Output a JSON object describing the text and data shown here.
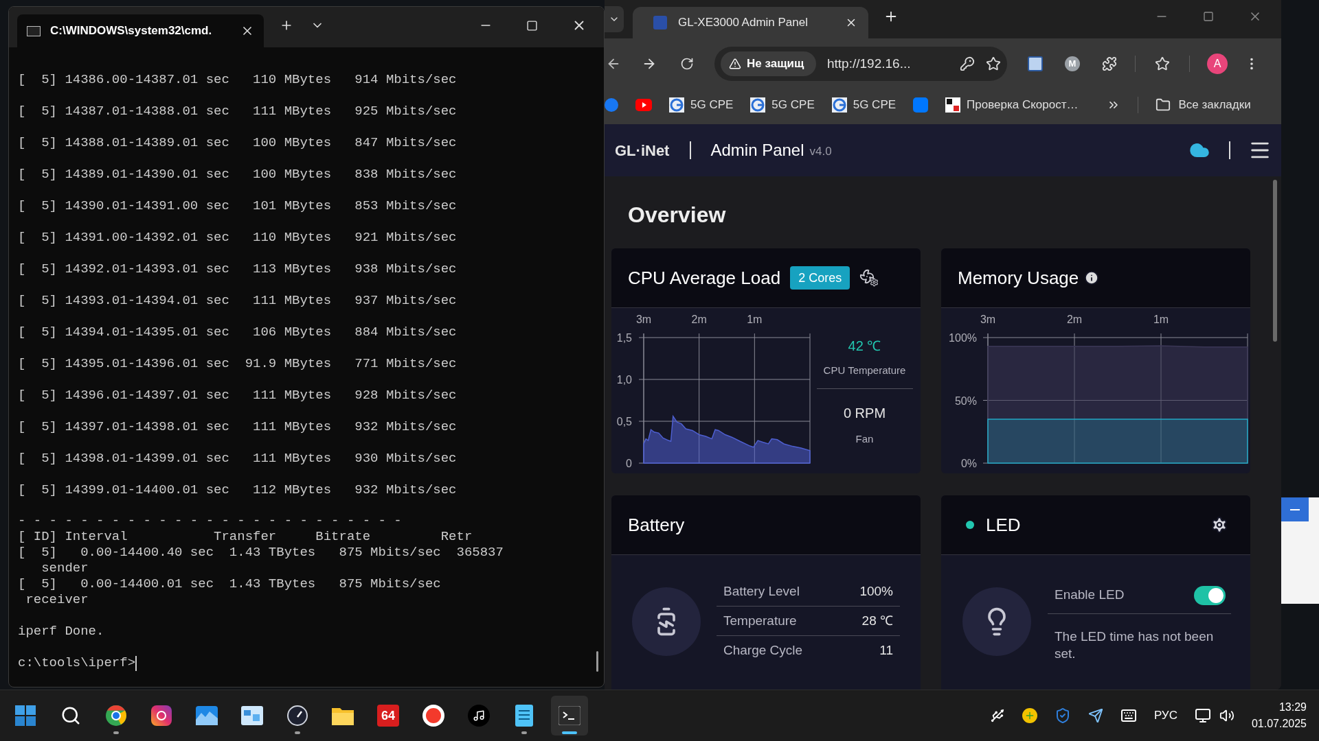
{
  "terminal": {
    "tab_title": "C:\\WINDOWS\\system32\\cmd.",
    "lines": [
      "[  5] 14386.00-14387.01 sec   110 MBytes   914 Mbits/sec",
      "[  5] 14387.01-14388.01 sec   111 MBytes   925 Mbits/sec",
      "[  5] 14388.01-14389.01 sec   100 MBytes   847 Mbits/sec",
      "[  5] 14389.01-14390.01 sec   100 MBytes   838 Mbits/sec",
      "[  5] 14390.01-14391.00 sec   101 MBytes   853 Mbits/sec",
      "[  5] 14391.00-14392.01 sec   110 MBytes   921 Mbits/sec",
      "[  5] 14392.01-14393.01 sec   113 MBytes   938 Mbits/sec",
      "[  5] 14393.01-14394.01 sec   111 MBytes   937 Mbits/sec",
      "[  5] 14394.01-14395.01 sec   106 MBytes   884 Mbits/sec",
      "[  5] 14395.01-14396.01 sec  91.9 MBytes   771 Mbits/sec",
      "[  5] 14396.01-14397.01 sec   111 MBytes   928 Mbits/sec",
      "[  5] 14397.01-14398.01 sec   111 MBytes   932 Mbits/sec",
      "[  5] 14398.01-14399.01 sec   111 MBytes   930 Mbits/sec",
      "[  5] 14399.01-14400.01 sec   112 MBytes   932 Mbits/sec"
    ],
    "summary": [
      "- - - - - - - - - - - - - - - - - - - - - - - - -",
      "[ ID] Interval           Transfer     Bitrate         Retr",
      "[  5]   0.00-14400.40 sec  1.43 TBytes   875 Mbits/sec  365837",
      "   sender",
      "[  5]   0.00-14400.01 sec  1.43 TBytes   875 Mbits/sec",
      " receiver"
    ],
    "done": "iperf Done.",
    "prompt": "c:\\tools\\iperf>"
  },
  "browser": {
    "tab_title": "GL-XE3000 Admin Panel",
    "security_chip": "Не защищ",
    "url": "http://192.16...",
    "profile_initial": "M",
    "avatar_initial": "A",
    "bookmarks": [
      {
        "kind": "blue-f"
      },
      {
        "kind": "red-play"
      },
      {
        "kind": "cpe",
        "label": "5G CPE"
      },
      {
        "kind": "cpe",
        "label": "5G CPE"
      },
      {
        "kind": "cpe",
        "label": "5G CPE"
      },
      {
        "kind": "vk"
      },
      {
        "kind": "hot",
        "label": "Проверка Скорост…"
      }
    ],
    "all_bookmarks": "Все закладки"
  },
  "page": {
    "logo": "GL·iNet",
    "app_title": "Admin Panel",
    "version": "v4.0",
    "heading": "Overview",
    "cpu": {
      "title": "CPU Average Load",
      "badge": "2 Cores",
      "temperature": "42 ℃",
      "temperature_label": "CPU Temperature",
      "fan_speed": "0 RPM",
      "fan_label": "Fan",
      "chart_data": {
        "type": "area",
        "x": [
          3,
          2.96,
          2.92,
          2.87,
          2.81,
          2.73,
          2.65,
          2.55,
          2.51,
          2.47,
          2.4,
          2.32,
          2.24,
          2.12,
          2,
          1.88,
          1.77,
          1.71,
          1.65,
          1.53,
          1.41,
          1.26,
          1.1,
          1.02,
          0.94,
          0.85,
          0.75,
          0.69,
          0.59,
          0.47,
          0.31,
          0.16,
          0
        ],
        "series": [
          {
            "color": "#4e5fd0",
            "values": [
              0.23,
              0.29,
              0.27,
              0.4,
              0.37,
              0.36,
              0.3,
              0.27,
              0.26,
              0.56,
              0.49,
              0.47,
              0.41,
              0.39,
              0.34,
              0.32,
              0.29,
              0.4,
              0.39,
              0.34,
              0.31,
              0.26,
              0.21,
              0.19,
              0.27,
              0.25,
              0.23,
              0.29,
              0.28,
              0.23,
              0.2,
              0.18,
              0.15
            ]
          }
        ],
        "xlim": [
          3,
          0
        ],
        "ylim": [
          0,
          1.5
        ],
        "grid": true,
        "xticks": [
          {
            "value": 3,
            "label": "3m"
          },
          {
            "value": 2,
            "label": "2m"
          },
          {
            "value": 1,
            "label": "1m"
          }
        ],
        "yticks": [
          {
            "value": 0,
            "label": "0"
          },
          {
            "value": 0.5,
            "label": "0,5"
          },
          {
            "value": 1,
            "label": "1,0"
          },
          {
            "value": 1.5,
            "label": "1,5"
          }
        ]
      }
    },
    "memory": {
      "title": "Memory Usage",
      "chart_data": {
        "type": "area",
        "x": [
          3,
          2.5,
          2,
          1.5,
          1,
          0.5,
          0
        ],
        "series": [
          {
            "color": "#3b3756",
            "values": [
              93,
              93,
              93,
              93,
              93.5,
              92.5,
              92.5
            ]
          },
          {
            "color": "#22a8c4",
            "values": [
              35,
              35,
              35,
              35,
              35,
              35,
              35
            ]
          }
        ],
        "xlim": [
          3,
          0
        ],
        "ylim": [
          0,
          100
        ],
        "grid": true,
        "xticks": [
          {
            "value": 3,
            "label": "3m"
          },
          {
            "value": 2,
            "label": "2m"
          },
          {
            "value": 1,
            "label": "1m"
          }
        ],
        "yticks": [
          {
            "value": 0,
            "label": "0%"
          },
          {
            "value": 50,
            "label": "50%"
          },
          {
            "value": 100,
            "label": "100%"
          }
        ]
      }
    },
    "battery": {
      "title": "Battery",
      "rows": [
        {
          "label": "Battery Level",
          "value": "100%"
        },
        {
          "label": "Temperature",
          "value": "28 ℃"
        },
        {
          "label": "Charge Cycle",
          "value": "11"
        }
      ]
    },
    "led": {
      "title": "LED",
      "active": true,
      "toggle_label": "Enable LED",
      "on": true,
      "note": "The LED time has not been set."
    }
  },
  "taskbar": {
    "apps": [
      {
        "kind": "start",
        "running": false,
        "active": false
      },
      {
        "kind": "search",
        "running": false,
        "active": false
      },
      {
        "kind": "chrome",
        "running": true,
        "active": false
      },
      {
        "kind": "camera",
        "running": false,
        "active": false
      },
      {
        "kind": "photos",
        "running": false,
        "active": false
      },
      {
        "kind": "board",
        "running": false,
        "active": false
      },
      {
        "kind": "gauge",
        "running": true,
        "active": false
      },
      {
        "kind": "folder",
        "running": false,
        "active": false
      },
      {
        "kind": "label",
        "label": "64",
        "running": false,
        "active": false
      },
      {
        "kind": "redcircle",
        "running": false,
        "active": false
      },
      {
        "kind": "note",
        "running": false,
        "active": false
      },
      {
        "kind": "notepad",
        "running": true,
        "active": false
      },
      {
        "kind": "terminal",
        "running": true,
        "active": true
      }
    ],
    "language": "РУС",
    "time": "13:29",
    "date": "01.07.2025"
  }
}
